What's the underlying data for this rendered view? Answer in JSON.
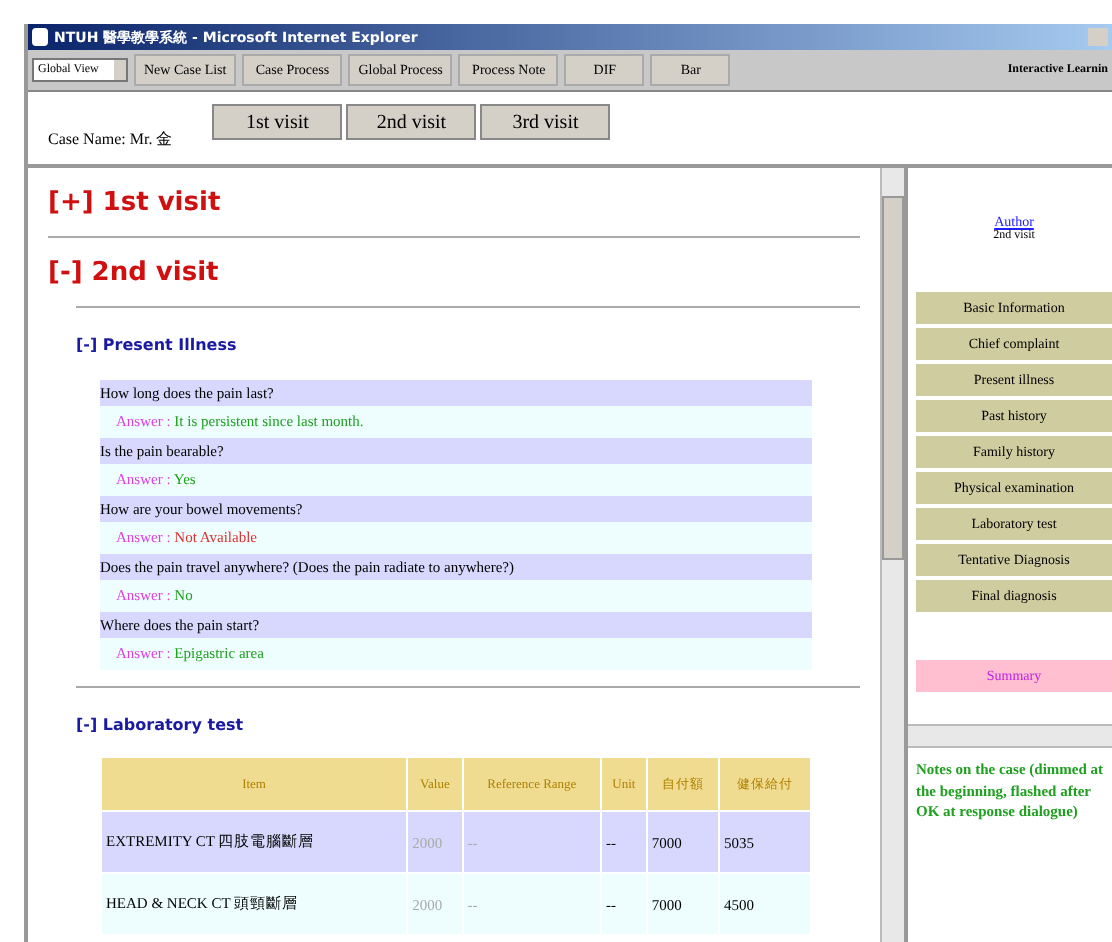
{
  "window": {
    "title": "NTUH 醫學教學系統 - Microsoft Internet Explorer"
  },
  "toolbar": {
    "view_select": "Global View",
    "buttons": [
      "New Case List",
      "Case Process",
      "Global Process",
      "Process Note",
      "DIF",
      "Bar"
    ],
    "app_name": "Interactive Learnin"
  },
  "case": {
    "label": "Case Name: Mr. 金",
    "visits": [
      "1st visit",
      "2nd visit",
      "3rd visit"
    ]
  },
  "visits": [
    {
      "toggle": "[+]",
      "title": "1st visit"
    },
    {
      "toggle": "[-]",
      "title": "2nd visit",
      "sections": [
        {
          "kind": "qa",
          "toggle": "[-]",
          "title": "Present Illness",
          "items": [
            {
              "question": "How long does the pain last?",
              "answer_label": "Answer :",
              "answer": "It is persistent since last month.",
              "kind": "normal"
            },
            {
              "question": "Is the pain bearable?",
              "answer_label": "Answer :",
              "answer": "Yes",
              "kind": "normal"
            },
            {
              "question": "How are your bowel movements?",
              "answer_label": "Answer :",
              "answer": "Not Available",
              "kind": "unavailable"
            },
            {
              "question": "Does the pain travel anywhere? (Does the pain radiate to anywhere?)",
              "answer_label": "Answer :",
              "answer": "No",
              "kind": "normal"
            },
            {
              "question": "Where does the pain start?",
              "answer_label": "Answer :",
              "answer": "Epigastric area",
              "kind": "normal"
            }
          ]
        },
        {
          "kind": "table",
          "toggle": "[-]",
          "title": "Laboratory test",
          "columns": [
            "Item",
            "Value",
            "Reference Range",
            "Unit",
            "自付額",
            "健保給付"
          ],
          "rows": [
            [
              "EXTREMITY CT 四肢電腦斷層",
              "2000",
              "--",
              "--",
              "7000",
              "5035"
            ],
            [
              "HEAD & NECK CT 頭頸斷層",
              "2000",
              "--",
              "--",
              "7000",
              "4500"
            ]
          ]
        }
      ]
    }
  ],
  "sidebar": {
    "author_link": "Author",
    "visit": "2nd visit",
    "items": [
      {
        "label": "Basic Information",
        "kind": "section"
      },
      {
        "label": "Chief complaint",
        "kind": "section"
      },
      {
        "label": "Present illness",
        "kind": "section"
      },
      {
        "label": "Past history",
        "kind": "section"
      },
      {
        "label": "Family history",
        "kind": "section"
      },
      {
        "label": "Physical examination",
        "kind": "section"
      },
      {
        "label": "Laboratory test",
        "kind": "section"
      },
      {
        "label": "Tentative Diagnosis",
        "kind": "section"
      },
      {
        "label": "Final diagnosis",
        "kind": "section"
      },
      {
        "label": "Summary",
        "kind": "summary"
      }
    ],
    "notes": "Notes on the case (dimmed at the beginning, flashed after OK at response dialogue)"
  }
}
